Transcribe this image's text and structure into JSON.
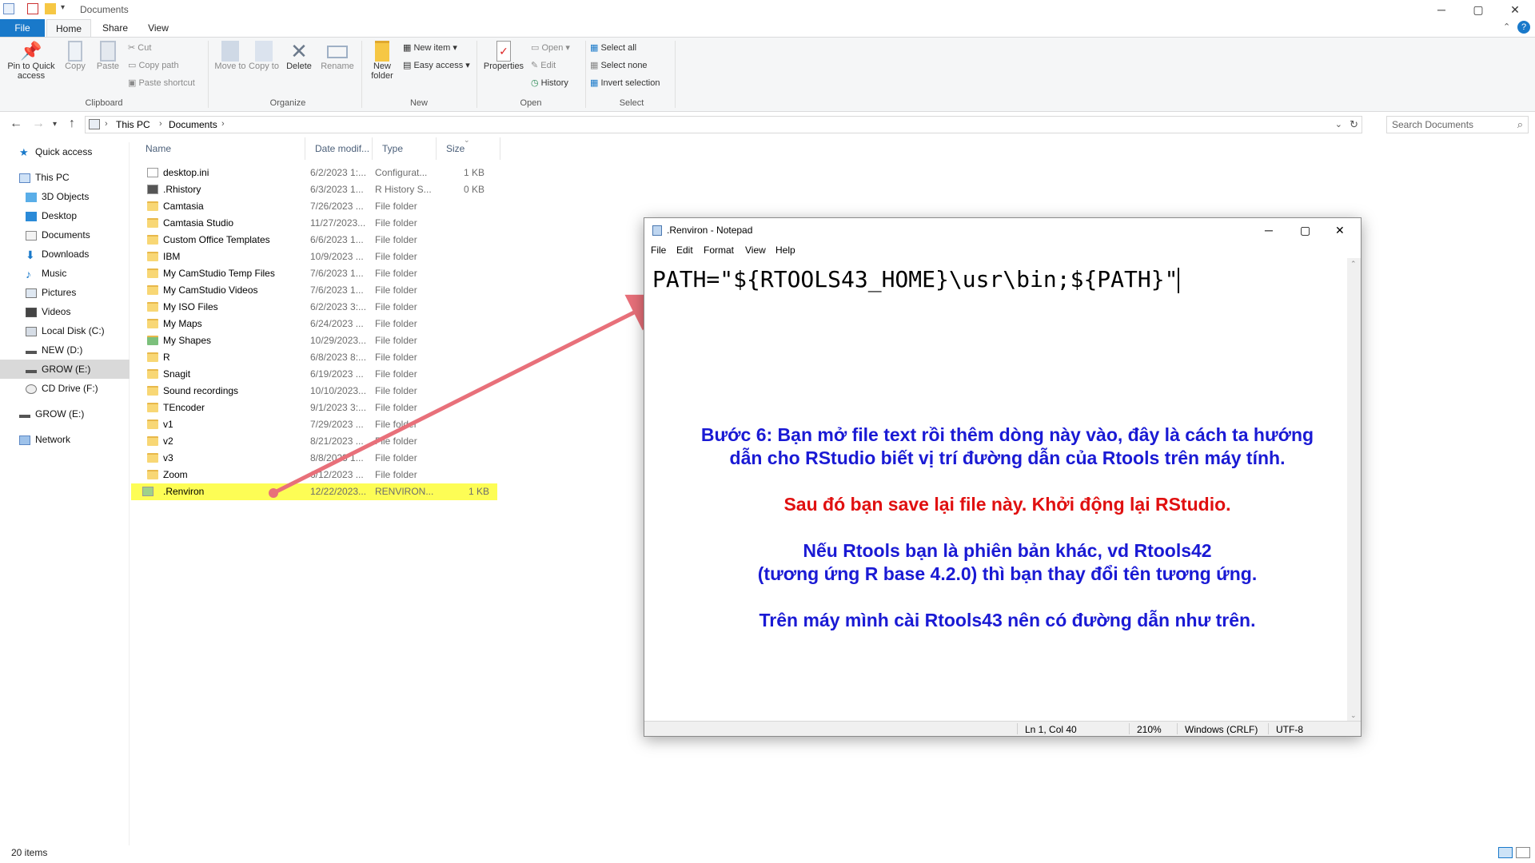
{
  "window": {
    "title": "Documents",
    "controls": {
      "minimize": "─",
      "maximize": "▢",
      "close": "✕"
    }
  },
  "ribbon_tabs": [
    "File",
    "Home",
    "Share",
    "View"
  ],
  "ribbon": {
    "clipboard": {
      "pin_label": "Pin to Quick access",
      "copy_label": "Copy",
      "paste_label": "Paste",
      "cut_label": "Cut",
      "copy_path_label": "Copy path",
      "paste_shortcut_label": "Paste shortcut",
      "group_label": "Clipboard"
    },
    "organize": {
      "move_to_label": "Move to",
      "copy_to_label": "Copy to",
      "delete_label": "Delete",
      "rename_label": "Rename",
      "group_label": "Organize"
    },
    "new": {
      "new_folder_label": "New folder",
      "new_item_label": "New item",
      "easy_access_label": "Easy access",
      "group_label": "New"
    },
    "open": {
      "properties_label": "Properties",
      "open_label": "Open",
      "edit_label": "Edit",
      "history_label": "History",
      "group_label": "Open"
    },
    "select": {
      "select_all_label": "Select all",
      "select_none_label": "Select none",
      "invert_selection_label": "Invert selection",
      "group_label": "Select"
    }
  },
  "address": {
    "path": [
      "This PC",
      "Documents"
    ],
    "search_placeholder": "Search Documents"
  },
  "sidebar": {
    "items": [
      {
        "label": "Quick access",
        "icon": "star-icon"
      },
      {
        "label": "This PC",
        "icon": "pc-icon"
      },
      {
        "label": "3D Objects",
        "icon": "cube-icon"
      },
      {
        "label": "Desktop",
        "icon": "desktop-icon"
      },
      {
        "label": "Documents",
        "icon": "documents-icon"
      },
      {
        "label": "Downloads",
        "icon": "download-icon"
      },
      {
        "label": "Music",
        "icon": "music-icon"
      },
      {
        "label": "Pictures",
        "icon": "pictures-icon"
      },
      {
        "label": "Videos",
        "icon": "videos-icon"
      },
      {
        "label": "Local Disk (C:)",
        "icon": "disk-icon"
      },
      {
        "label": "NEW (D:)",
        "icon": "drive-icon"
      },
      {
        "label": "GROW (E:)",
        "icon": "drive-icon"
      },
      {
        "label": "CD Drive (F:)",
        "icon": "cd-icon"
      },
      {
        "label": "GROW (E:)",
        "icon": "drive-icon"
      },
      {
        "label": "Network",
        "icon": "network-icon"
      }
    ]
  },
  "file_list": {
    "columns": [
      "Name",
      "Date modif...",
      "Type",
      "Size"
    ],
    "rows": [
      {
        "name": "desktop.ini",
        "date": "6/2/2023 1:...",
        "type": "Configurat...",
        "size": "1 KB",
        "icon": "ini-file-icon"
      },
      {
        "name": ".Rhistory",
        "date": "6/3/2023 1...",
        "type": "R History S...",
        "size": "0 KB",
        "icon": "rhistory-file-icon"
      },
      {
        "name": "Camtasia",
        "date": "7/26/2023 ...",
        "type": "File folder",
        "size": "",
        "icon": "folder-icon"
      },
      {
        "name": "Camtasia Studio",
        "date": "11/27/2023...",
        "type": "File folder",
        "size": "",
        "icon": "folder-icon"
      },
      {
        "name": "Custom Office Templates",
        "date": "6/6/2023 1...",
        "type": "File folder",
        "size": "",
        "icon": "folder-icon"
      },
      {
        "name": "IBM",
        "date": "10/9/2023 ...",
        "type": "File folder",
        "size": "",
        "icon": "folder-icon"
      },
      {
        "name": "My CamStudio Temp Files",
        "date": "7/6/2023 1...",
        "type": "File folder",
        "size": "",
        "icon": "folder-icon"
      },
      {
        "name": "My CamStudio Videos",
        "date": "7/6/2023 1...",
        "type": "File folder",
        "size": "",
        "icon": "folder-icon"
      },
      {
        "name": "My ISO Files",
        "date": "6/2/2023 3:...",
        "type": "File folder",
        "size": "",
        "icon": "folder-icon"
      },
      {
        "name": "My Maps",
        "date": "6/24/2023 ...",
        "type": "File folder",
        "size": "",
        "icon": "folder-icon"
      },
      {
        "name": "My Shapes",
        "date": "10/29/2023...",
        "type": "File folder",
        "size": "",
        "icon": "shapes-folder-icon"
      },
      {
        "name": "R",
        "date": "6/8/2023 8:...",
        "type": "File folder",
        "size": "",
        "icon": "folder-icon"
      },
      {
        "name": "Snagit",
        "date": "6/19/2023 ...",
        "type": "File folder",
        "size": "",
        "icon": "folder-icon"
      },
      {
        "name": "Sound recordings",
        "date": "10/10/2023...",
        "type": "File folder",
        "size": "",
        "icon": "folder-icon"
      },
      {
        "name": "TEncoder",
        "date": "9/1/2023 3:...",
        "type": "File folder",
        "size": "",
        "icon": "folder-icon"
      },
      {
        "name": "v1",
        "date": "7/29/2023 ...",
        "type": "File folder",
        "size": "",
        "icon": "folder-icon"
      },
      {
        "name": "v2",
        "date": "8/21/2023 ...",
        "type": "File folder",
        "size": "",
        "icon": "folder-icon"
      },
      {
        "name": "v3",
        "date": "8/8/2023 1...",
        "type": "File folder",
        "size": "",
        "icon": "folder-icon"
      },
      {
        "name": "Zoom",
        "date": "6/12/2023 ...",
        "type": "File folder",
        "size": "",
        "icon": "folder-icon"
      },
      {
        "name": ".Renviron",
        "date": "12/22/2023...",
        "type": "RENVIRON...",
        "size": "1 KB",
        "icon": "renviron-file-icon",
        "highlighted": true
      }
    ]
  },
  "status_bar": {
    "item_count": "20 items"
  },
  "notepad": {
    "title": ".Renviron - Notepad",
    "menu": [
      "File",
      "Edit",
      "Format",
      "View",
      "Help"
    ],
    "content": "PATH=\"${RTOOLS43_HOME}\\usr\\bin;${PATH}\"",
    "status": {
      "position": "Ln 1, Col 40",
      "zoom": "210%",
      "line_endings": "Windows (CRLF)",
      "encoding": "UTF-8"
    }
  },
  "annotation": {
    "step": "Bước 6: Bạn mở file text rồi thêm dòng này vào, đây là cách ta hướng",
    "step_line2": "dẫn cho RStudio biết vị trí đường dẫn của Rtools trên máy tính.",
    "save_note": "Sau đó bạn save lại file này. Khởi động lại RStudio.",
    "version_note_1": "Nếu Rtools bạn là phiên bản khác, vd Rtools42",
    "version_note_2": "(tương ứng R base 4.2.0) thì bạn thay đổi tên tương ứng.",
    "final_note": "Trên máy mình cài Rtools43 nên có đường dẫn như trên.",
    "colors": {
      "blue": "#1a1ad4",
      "red": "#e01010",
      "arrow": "#e8707a",
      "highlight": "#fdfd55"
    }
  }
}
